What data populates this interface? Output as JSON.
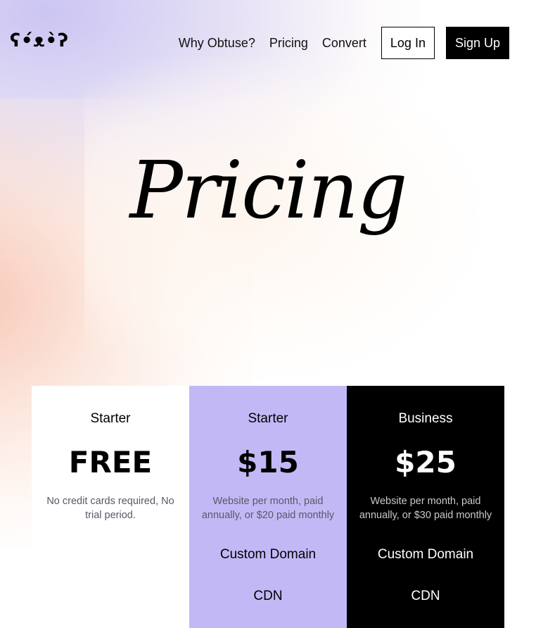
{
  "brand": {
    "logo_text": "ʕ•́ᴥ•̀ʔ"
  },
  "nav": {
    "links": [
      "Why Obtuse?",
      "Pricing",
      "Convert"
    ],
    "login_label": "Log In",
    "signup_label": "Sign Up"
  },
  "hero": {
    "title": "Pricing"
  },
  "plans": [
    {
      "name": "Starter",
      "price": "FREE",
      "description": "No credit cards required, No trial period.",
      "features": [],
      "background": "#ffffff"
    },
    {
      "name": "Starter",
      "price": "$15",
      "description": "Website per month, paid annually, or $20 paid monthly",
      "features": [
        "Custom Domain",
        "CDN"
      ],
      "background": "#c3b8f6"
    },
    {
      "name": "Business",
      "price": "$25",
      "description": "Website per month, paid annually, or $30 paid monthly",
      "features": [
        "Custom Domain",
        "CDN"
      ],
      "background": "#000000"
    }
  ]
}
